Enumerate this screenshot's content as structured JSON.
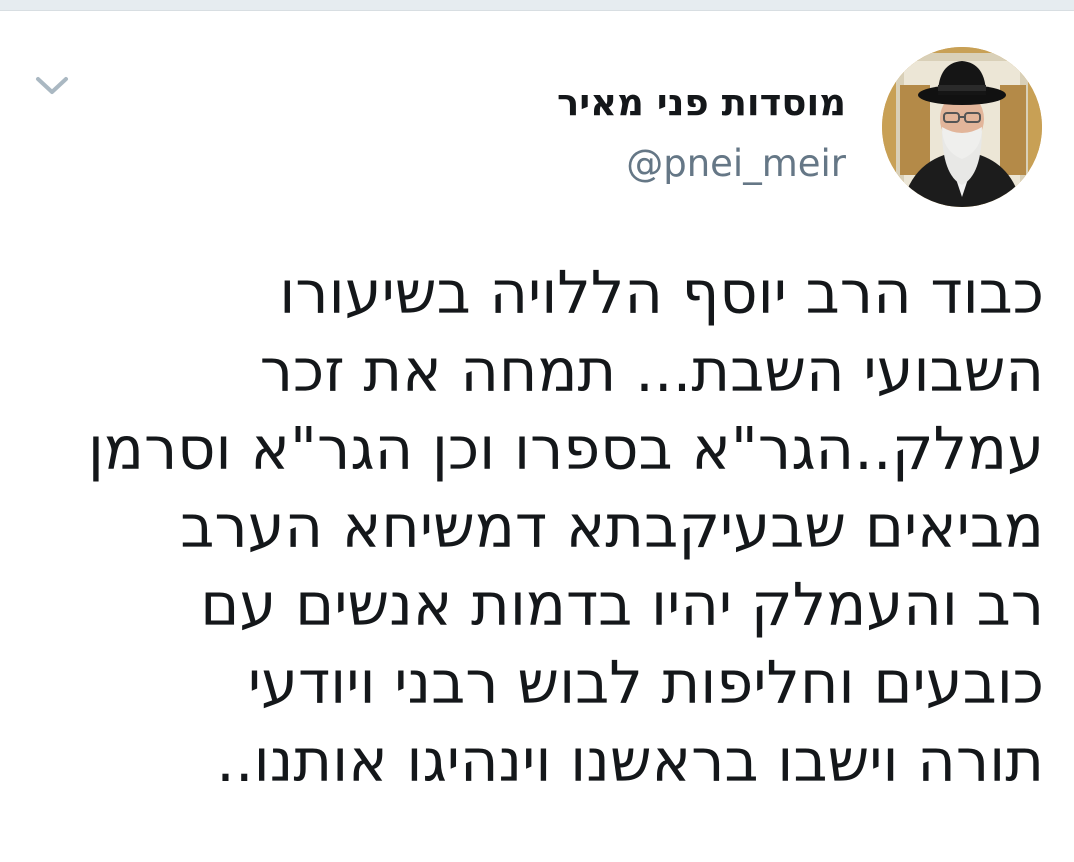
{
  "account": {
    "display_name": "מוסדות פני מאיר",
    "handle": "@pnei_meir",
    "avatar_icon": "profile-photo"
  },
  "menu": {
    "caret_icon": "chevron-down-icon"
  },
  "tweet": {
    "lines": [
      "כבוד הרב יוסף הללויה בשיעורו",
      "השבועי השבת... תמחה את זכר",
      "עמלק..הגר\"א בספרו וכן הגר\"א וסרמן",
      "מביאים שבעיקבתא דמשיחא הערב",
      "רב והעמלק יהיו בדמות אנשים עם",
      "כובעים וחליפות לבוש רבני ויודעי",
      "תורה וישבו בראשנו וינהיגו אותנו.."
    ]
  },
  "colors": {
    "text_primary": "#14171a",
    "text_secondary": "#657786",
    "caret": "#aab8c2",
    "divider": "#e6ecf0"
  }
}
